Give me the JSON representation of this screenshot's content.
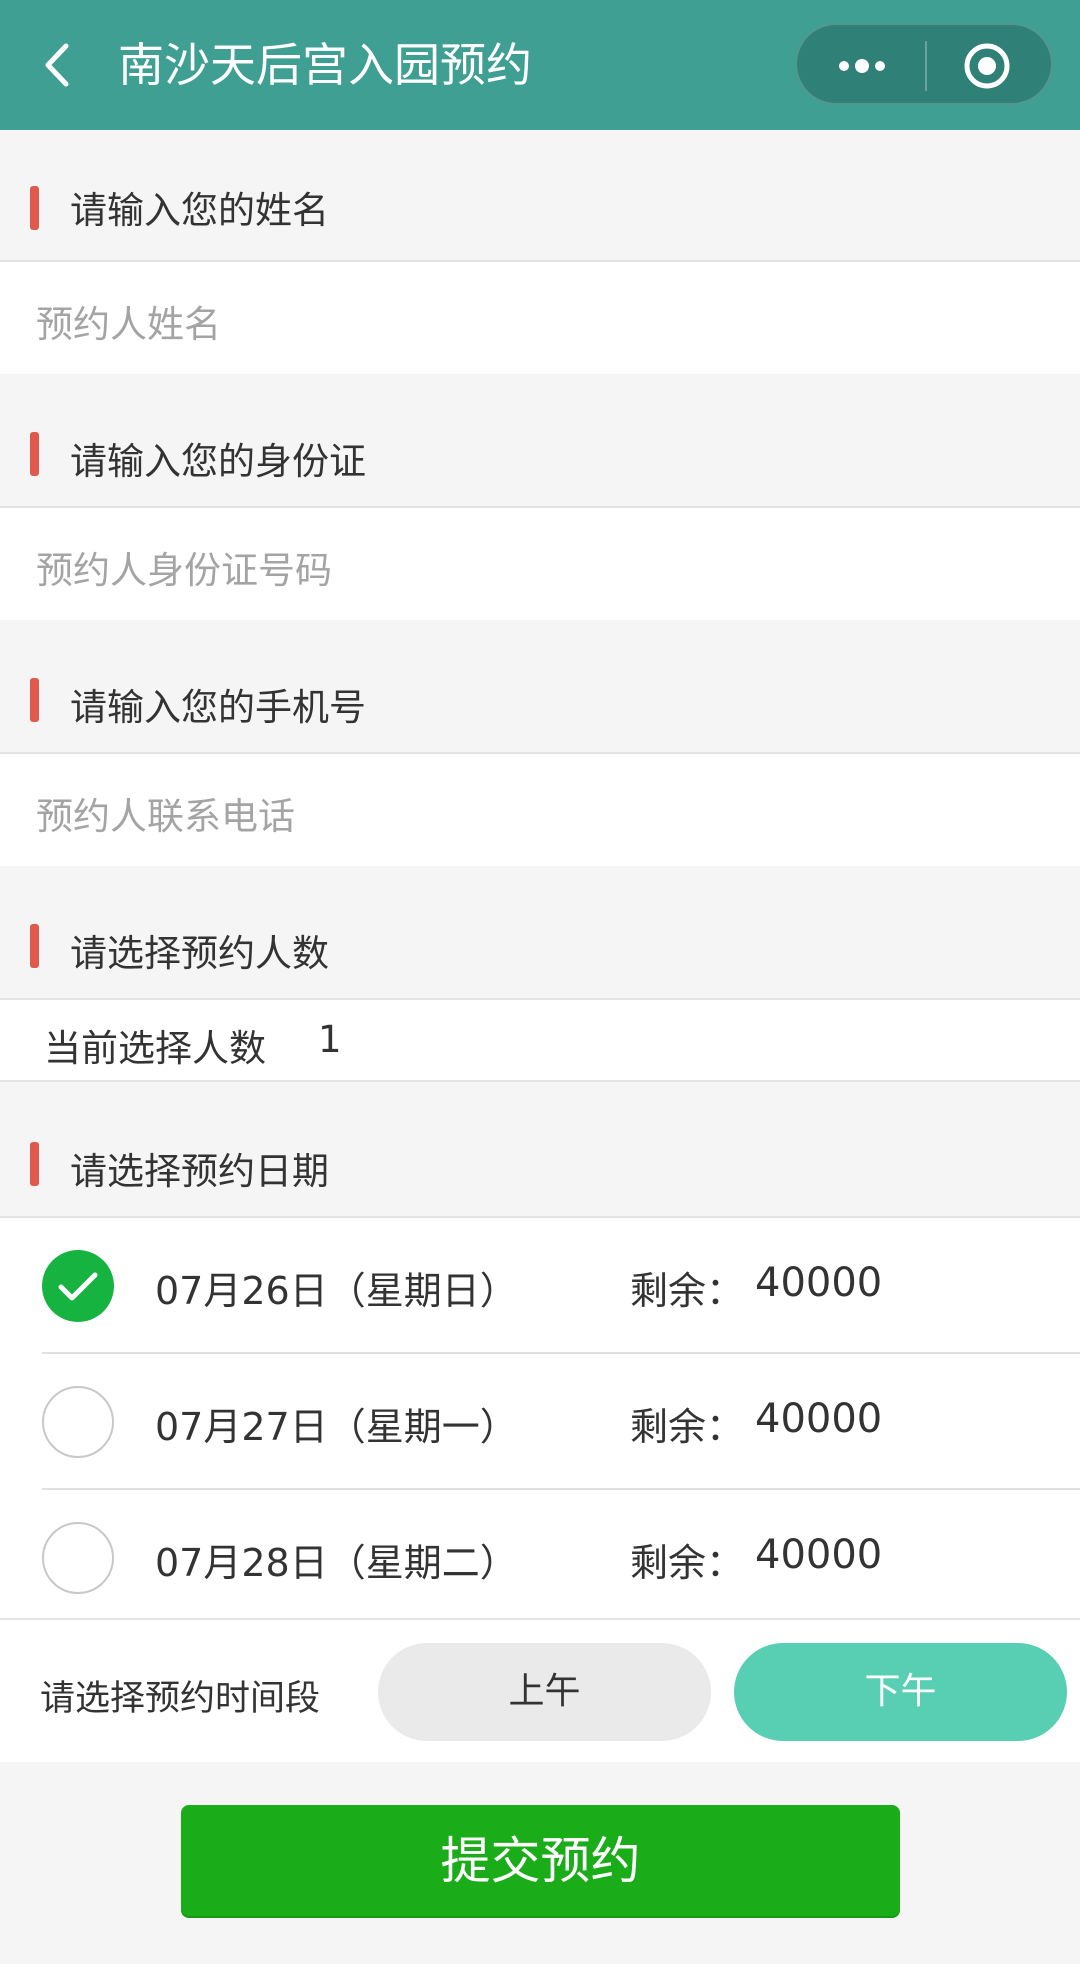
{
  "header": {
    "title": "南沙天后宫入园预约",
    "back_icon": "chevron-left-icon",
    "more_icon": "more-dots-icon",
    "target_icon": "target-icon"
  },
  "form": {
    "name": {
      "title": "请输入您的姓名",
      "placeholder": "预约人姓名"
    },
    "id_card": {
      "title": "请输入您的身份证",
      "placeholder": "预约人身份证号码"
    },
    "phone": {
      "title": "请输入您的手机号",
      "placeholder": "预约人联系电话"
    },
    "people_count": {
      "title": "请选择预约人数",
      "label": "当前选择人数",
      "value": "1"
    },
    "date": {
      "title": "请选择预约日期",
      "items": [
        {
          "label": "07月26日（星期日）",
          "remain_label": "剩余：",
          "remain_value": "40000",
          "selected": true
        },
        {
          "label": "07月27日（星期一）",
          "remain_label": "剩余：",
          "remain_value": "40000",
          "selected": false
        },
        {
          "label": "07月28日（星期二）",
          "remain_label": "剩余：",
          "remain_value": "40000",
          "selected": false
        }
      ]
    },
    "time_period": {
      "label": "请选择预约时间段",
      "morning": "上午",
      "afternoon": "下午",
      "selected": "下午"
    }
  },
  "submit": {
    "label": "提交预约"
  },
  "colors": {
    "header": "#3f9f92",
    "accent_bar": "#e05a4c",
    "selected_radio": "#16b341",
    "selected_time": "#58cfb2",
    "submit": "#1aad19"
  }
}
